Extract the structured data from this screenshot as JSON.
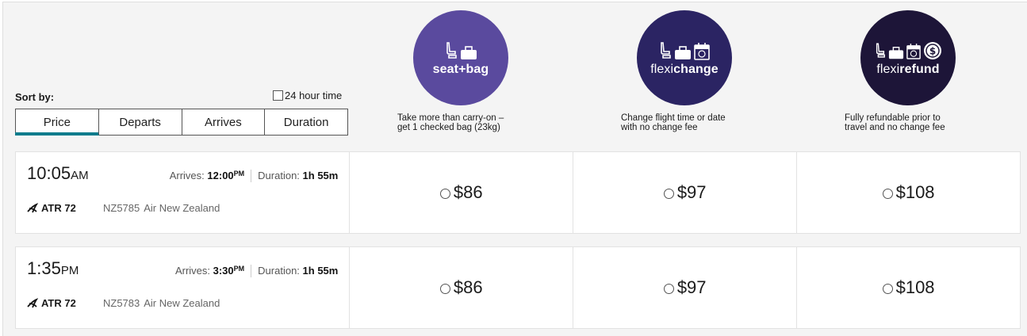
{
  "sort": {
    "label": "Sort by:",
    "hour_toggle_label": "24 hour time",
    "tabs": [
      "Price",
      "Departs",
      "Arrives",
      "Duration"
    ],
    "active_tab": "Price"
  },
  "fares": [
    {
      "name_a": "seat",
      "name_b": "+bag",
      "color": "#5a4a9e",
      "icons": [
        "seat-icon",
        "bag-icon"
      ],
      "desc_1": "Take more than carry-on –",
      "desc_2": "get 1 checked bag (23kg)"
    },
    {
      "name_a": "flexi",
      "name_b": "change",
      "color": "#2b2463",
      "icons": [
        "seat-icon",
        "bag-icon",
        "calendar-icon"
      ],
      "desc_1": "Change flight time or date",
      "desc_2": "with no change fee"
    },
    {
      "name_a": "flexi",
      "name_b": "refund",
      "color": "#1d1538",
      "icons": [
        "seat-icon",
        "bag-icon",
        "calendar-icon",
        "dollar-icon"
      ],
      "desc_1": "Fully refundable prior to",
      "desc_2": "travel and no change fee"
    }
  ],
  "flights": [
    {
      "departs": "10:05",
      "departs_ampm": "AM",
      "arrives_label": "Arrives:",
      "arrives": "12:00",
      "arrives_ampm": "PM",
      "duration_label": "Duration:",
      "duration": "1h 55m",
      "aircraft": "ATR 72",
      "flight_no": "NZ5785",
      "airline": "Air New Zealand",
      "prices": [
        "$86",
        "$97",
        "$108"
      ]
    },
    {
      "departs": "1:35",
      "departs_ampm": "PM",
      "arrives_label": "Arrives:",
      "arrives": "3:30",
      "arrives_ampm": "PM",
      "duration_label": "Duration:",
      "duration": "1h 55m",
      "aircraft": "ATR 72",
      "flight_no": "NZ5783",
      "airline": "Air New Zealand",
      "prices": [
        "$86",
        "$97",
        "$108"
      ]
    }
  ]
}
